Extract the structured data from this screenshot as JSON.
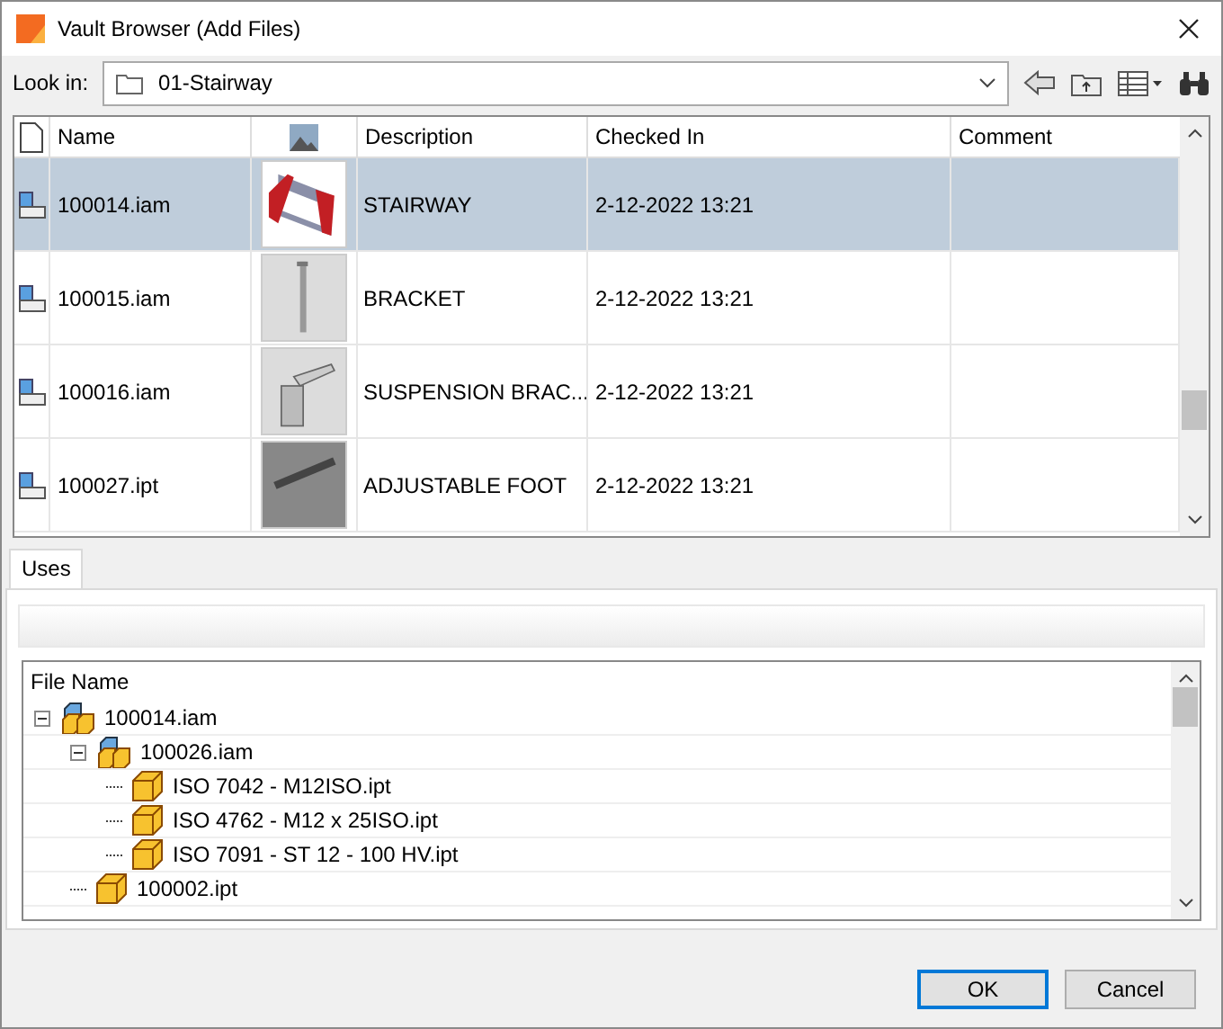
{
  "window": {
    "title": "Vault Browser (Add Files)"
  },
  "look_in": {
    "label": "Look in:",
    "value": "01-Stairway"
  },
  "table": {
    "columns": [
      "Name",
      "Description",
      "Checked In",
      "Comment"
    ],
    "rows": [
      {
        "name": "100014.iam",
        "description": "STAIRWAY",
        "checked_in": "2-12-2022 13:21",
        "selected": true
      },
      {
        "name": "100015.iam",
        "description": "BRACKET",
        "checked_in": "2-12-2022 13:21",
        "selected": false
      },
      {
        "name": "100016.iam",
        "description": "SUSPENSION BRAC...",
        "checked_in": "2-12-2022 13:21",
        "selected": false
      },
      {
        "name": "100027.ipt",
        "description": "ADJUSTABLE FOOT",
        "checked_in": "2-12-2022 13:21",
        "selected": false
      }
    ]
  },
  "tabs": [
    {
      "label": "Uses",
      "selected": true
    }
  ],
  "tree": {
    "header": "File Name",
    "items": [
      {
        "name": "100014.iam",
        "kind": "assembly",
        "expanded": true,
        "children": [
          {
            "name": "100026.iam",
            "kind": "assembly",
            "expanded": true,
            "children": [
              {
                "name": "ISO 7042 - M12ISO.ipt",
                "kind": "part"
              },
              {
                "name": "ISO 4762 - M12 x 25ISO.ipt",
                "kind": "part"
              },
              {
                "name": "ISO 7091 - ST 12 - 100 HV.ipt",
                "kind": "part"
              }
            ]
          },
          {
            "name": "100002.ipt",
            "kind": "part"
          }
        ]
      }
    ]
  },
  "buttons": [
    "OK",
    "Cancel"
  ]
}
